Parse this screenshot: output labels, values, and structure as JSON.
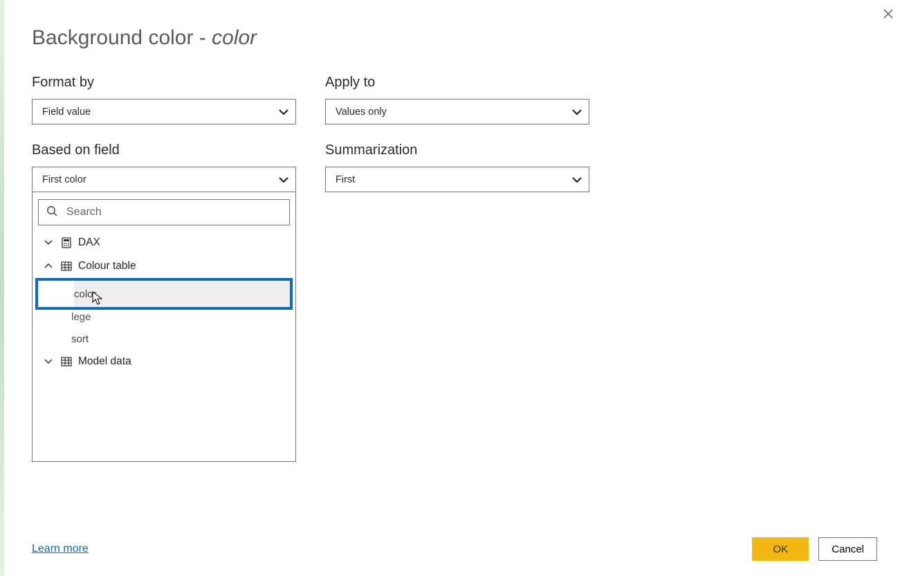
{
  "colors": {
    "accent": "#0d6cbe",
    "primary_btn": "#f2b80f"
  },
  "dialog": {
    "title_prefix": "Background color - ",
    "title_em": "color",
    "close_tooltip": "Close"
  },
  "fields": {
    "format_by": {
      "label": "Format by",
      "value": "Field value"
    },
    "apply_to": {
      "label": "Apply to",
      "value": "Values only"
    },
    "based_on": {
      "label": "Based on field",
      "value": "First color"
    },
    "summarization": {
      "label": "Summarization",
      "value": "First"
    }
  },
  "field_picker": {
    "search_placeholder": "Search",
    "tree": [
      {
        "name": "DAX",
        "kind": "measure_group",
        "expanded": false
      },
      {
        "name": "Colour table",
        "kind": "table",
        "expanded": true,
        "children": [
          {
            "name": "color",
            "selected": true
          },
          {
            "name": "lege",
            "selected": false,
            "partially_obscured": true
          },
          {
            "name": "sort",
            "selected": false
          }
        ]
      },
      {
        "name": "Model data",
        "kind": "table",
        "expanded": false
      }
    ]
  },
  "footer": {
    "learn_more": "Learn more",
    "ok": "OK",
    "cancel": "Cancel"
  }
}
